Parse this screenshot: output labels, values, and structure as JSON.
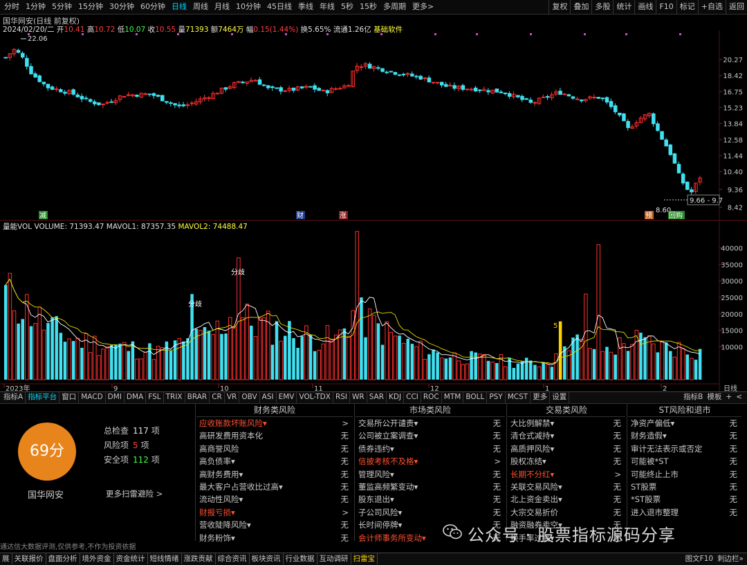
{
  "toolbar": {
    "periods": [
      "分时",
      "1分钟",
      "5分钟",
      "15分钟",
      "30分钟",
      "60分钟",
      "日线",
      "周线",
      "月线",
      "10分钟",
      "45日线",
      "季线",
      "年线",
      "5秒",
      "15秒",
      "多周期",
      "更多>"
    ],
    "active_period": "日线",
    "right_buttons": [
      "复权",
      "叠加",
      "多股",
      "统计",
      "画线",
      "F10",
      "标记",
      "+自选",
      "返回"
    ]
  },
  "info": {
    "title": "国华网安(日线 前复权)",
    "date": "2024/02/20/二",
    "open_label": "开",
    "open": "10.41",
    "high_label": "高",
    "high": "10.72",
    "low_label": "低",
    "low": "10.07",
    "close_label": "收",
    "close": "10.55",
    "vol_label": "量",
    "vol": "71393",
    "amount_label": "额",
    "amount": "7464万",
    "change_label": "幅",
    "change": "0.15(1.44%)",
    "turnover_label": "换",
    "turnover": "5.65%",
    "float_label": "流通",
    "float": "1.26亿",
    "software": "基础软件"
  },
  "price_axis": [
    "20.27",
    "18.42",
    "16.75",
    "15.23",
    "13.84",
    "12.58",
    "11.44",
    "10.40",
    "9.36",
    "8.42"
  ],
  "price_annotations": {
    "high": "22.06",
    "low": "8.60",
    "range": "9.66 - 9.7"
  },
  "event_markers": [
    "减",
    "财",
    "涨",
    "预",
    "回购"
  ],
  "volume": {
    "name": "量能VOL",
    "volume_label": "VOLUME:",
    "volume": "71393.47",
    "mavol1_label": "MAVOL1:",
    "mavol1": "87357.35",
    "mavol2_label": "MAVOL2:",
    "mavol2": "74488.47",
    "axis": [
      "40000",
      "35000",
      "30000",
      "25000",
      "20000",
      "15000",
      "10000"
    ],
    "annotations": [
      "分歧",
      "分歧",
      "5"
    ]
  },
  "date_axis": [
    "2023年",
    "9",
    "10",
    "11",
    "12",
    "1",
    "2"
  ],
  "date_mode": "日线",
  "indicator_tabs": [
    "指标A",
    "指标平台",
    "窗口",
    "MACD",
    "DMI",
    "DMA",
    "FSL",
    "TRIX",
    "BRAR",
    "CR",
    "VR",
    "OBV",
    "ASI",
    "EMV",
    "VOL-TDX",
    "RSI",
    "WR",
    "SAR",
    "KDJ",
    "CCI",
    "ROC",
    "MTM",
    "BOLL",
    "PSY",
    "MCST",
    "更多",
    "设置"
  ],
  "indicator_active": "指标平台",
  "indicator_right": [
    "指标B",
    "模板",
    "+",
    "<"
  ],
  "scan": {
    "score": "69分",
    "stock_name": "国华网安",
    "total_label": "总检查",
    "total": "117",
    "total_unit": "项",
    "risk_label": "风险项",
    "risk": "5",
    "risk_unit": "项",
    "safe_label": "安全项",
    "safe": "112",
    "safe_unit": "项",
    "more": "更多扫雷避险 >",
    "disclaimer": "通达信大数据评测,仅供参考,不作为投资依据",
    "columns": [
      {
        "title": "财务类风险",
        "rows": [
          {
            "label": "应收账款坏账风险▾",
            "result": ">",
            "warn": true
          },
          {
            "label": "高研发费用资本化",
            "result": "无",
            "warn": false
          },
          {
            "label": "高商誉风险",
            "result": "无",
            "warn": false
          },
          {
            "label": "高负债率▾",
            "result": "无",
            "warn": false
          },
          {
            "label": "高财务费用▾",
            "result": "无",
            "warn": false
          },
          {
            "label": "最大客户占营收比过高▾",
            "result": "无",
            "warn": false
          },
          {
            "label": "流动性风险▾",
            "result": "无",
            "warn": false
          },
          {
            "label": "财报亏损▾",
            "result": ">",
            "warn": true
          },
          {
            "label": "营收陡降风险▾",
            "result": "无",
            "warn": false
          },
          {
            "label": "财务粉饰▾",
            "result": "无",
            "warn": false
          }
        ]
      },
      {
        "title": "市场类风险",
        "rows": [
          {
            "label": "交易所公开谴责▾",
            "result": "无",
            "warn": false
          },
          {
            "label": "公司被立案调查▾",
            "result": "无",
            "warn": false
          },
          {
            "label": "债券违约▾",
            "result": "无",
            "warn": false
          },
          {
            "label": "信披考核不及格▾",
            "result": ">",
            "warn": true
          },
          {
            "label": "管理风险▾",
            "result": "无",
            "warn": false
          },
          {
            "label": "董监高频繁变动▾",
            "result": "无",
            "warn": false
          },
          {
            "label": "股东退出▾",
            "result": "无",
            "warn": false
          },
          {
            "label": "子公司风险▾",
            "result": "无",
            "warn": false
          },
          {
            "label": "长时间停牌▾",
            "result": "无",
            "warn": false
          },
          {
            "label": "会计师事务所变动▾",
            "result": "无",
            "warn": true
          }
        ]
      },
      {
        "title": "交易类风险",
        "rows": [
          {
            "label": "大比例解禁▾",
            "result": "无",
            "warn": false
          },
          {
            "label": "清仓式减持▾",
            "result": "无",
            "warn": false
          },
          {
            "label": "高质押风险▾",
            "result": "无",
            "warn": false
          },
          {
            "label": "股权冻结▾",
            "result": "无",
            "warn": false
          },
          {
            "label": "长期不分红▾",
            "result": ">",
            "warn": true
          },
          {
            "label": "关联交易风险▾",
            "result": "无",
            "warn": false
          },
          {
            "label": "北上资金卖出▾",
            "result": "无",
            "warn": false
          },
          {
            "label": "大宗交易折价",
            "result": "无",
            "warn": false
          },
          {
            "label": "融资融券卖空▾",
            "result": "无",
            "warn": false
          },
          {
            "label": "换手率过高▾",
            "result": "无",
            "warn": false
          }
        ]
      },
      {
        "title": "ST风险和退市",
        "rows": [
          {
            "label": "净资产偏低▾",
            "result": "无",
            "warn": false
          },
          {
            "label": "财务造假▾",
            "result": "无",
            "warn": false
          },
          {
            "label": "审计无法表示或否定",
            "result": "无",
            "warn": false
          },
          {
            "label": "可能被*ST",
            "result": "无",
            "warn": false
          },
          {
            "label": "可能终止上市",
            "result": "无",
            "warn": false
          },
          {
            "label": "ST股票",
            "result": "无",
            "warn": false
          },
          {
            "label": "*ST股票",
            "result": "无",
            "warn": false
          },
          {
            "label": "进入退市整理",
            "result": "无",
            "warn": false
          }
        ]
      }
    ]
  },
  "bottom_tabs": [
    "展",
    "关联报价",
    "盘面分析",
    "境外资金",
    "资金统计",
    "短线情绪",
    "涨跌贡献",
    "综合资讯",
    "板块资讯",
    "行业数据",
    "互动调研",
    "扫雷宝"
  ],
  "bottom_active": "扫雷宝",
  "bottom_right": [
    "图文F10",
    "刺边栏»"
  ],
  "watermark": "公众号 · 股票指标源码分享",
  "colors": {
    "up": "#ff3030",
    "down": "#40e0f0",
    "score_bg": "#e8841c",
    "warn": "#ff5030",
    "ma1": "#ffffff",
    "ma2": "#e8e000",
    "highlight_bar": "#ffd000"
  }
}
